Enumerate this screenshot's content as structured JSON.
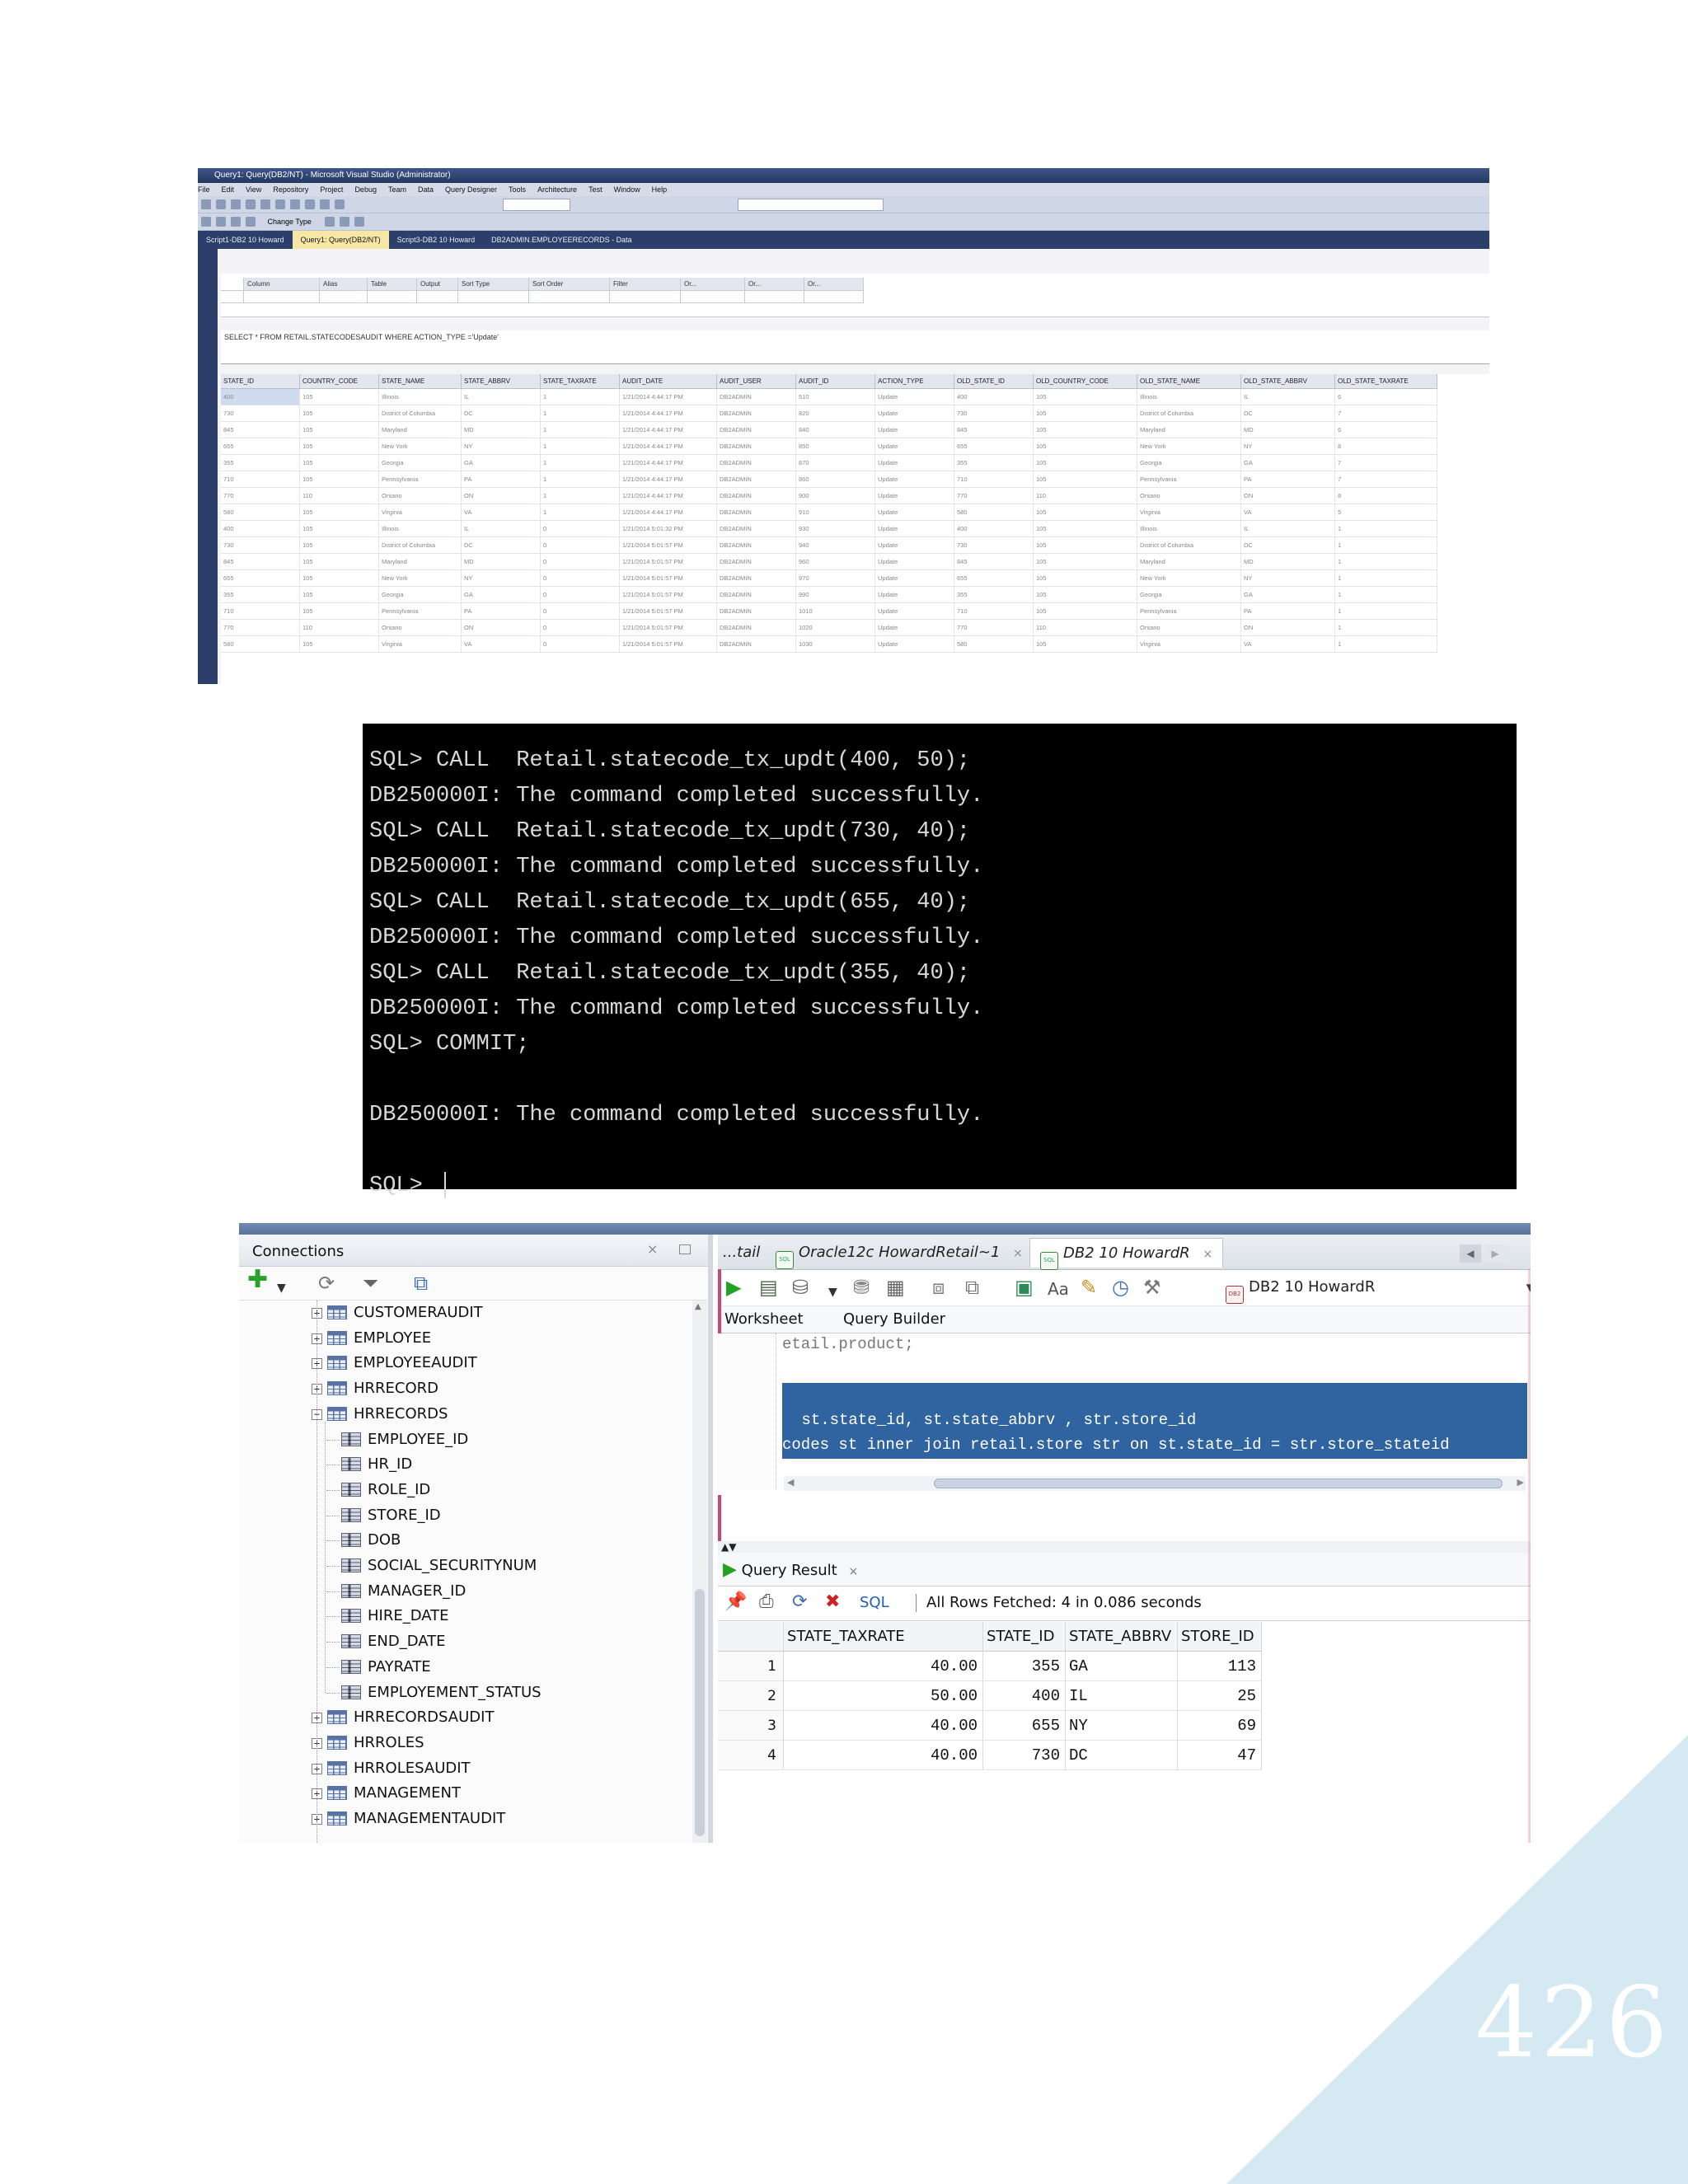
{
  "page_number": "426",
  "visual_studio": {
    "title": "Query1: Query(DB2/NT) - Microsoft Visual Studio (Administrator)",
    "menu": [
      "File",
      "Edit",
      "View",
      "Repository",
      "Project",
      "Debug",
      "Team",
      "Data",
      "Query Designer",
      "Tools",
      "Architecture",
      "Test",
      "Window",
      "Help"
    ],
    "change_type_label": "Change Type",
    "tabs": [
      "Script1-DB2 10 Howard",
      "Query1: Query(DB2/NT)",
      "Script3-DB2 10 Howard",
      "DB2ADMIN.EMPLOYEERECORDS - Data"
    ],
    "criteria_headers": [
      "Column",
      "Alias",
      "Table",
      "Output",
      "Sort Type",
      "Sort Order",
      "Filter",
      "Or...",
      "Or...",
      "Or..."
    ],
    "sql_text": "SELECT * FROM RETAIL.STATECODESAUDIT WHERE ACTION_TYPE ='Update'",
    "result_columns": [
      "STATE_ID",
      "COUNTRY_CODE",
      "STATE_NAME",
      "STATE_ABBRV",
      "STATE_TAXRATE",
      "AUDIT_DATE",
      "AUDIT_USER",
      "AUDIT_ID",
      "ACTION_TYPE",
      "OLD_STATE_ID",
      "OLD_COUNTRY_CODE",
      "OLD_STATE_NAME",
      "OLD_STATE_ABBRV",
      "OLD_STATE_TAXRATE"
    ],
    "result_rows": [
      [
        "400",
        "105",
        "Illinois",
        "IL",
        "1",
        "1/21/2014 4:44:17 PM",
        "DB2ADMIN",
        "510",
        "Update",
        "400",
        "105",
        "Illinois",
        "IL",
        "6"
      ],
      [
        "730",
        "105",
        "District of Columbia",
        "DC",
        "1",
        "1/21/2014 4:44:17 PM",
        "DB2ADMIN",
        "820",
        "Update",
        "730",
        "105",
        "District of Columbia",
        "DC",
        "7"
      ],
      [
        "845",
        "105",
        "Maryland",
        "MD",
        "1",
        "1/21/2014 4:44:17 PM",
        "DB2ADMIN",
        "840",
        "Update",
        "845",
        "105",
        "Maryland",
        "MD",
        "6"
      ],
      [
        "655",
        "105",
        "New York",
        "NY",
        "1",
        "1/21/2014 4:44:17 PM",
        "DB2ADMIN",
        "850",
        "Update",
        "655",
        "105",
        "New York",
        "NY",
        "8"
      ],
      [
        "355",
        "105",
        "Georgia",
        "GA",
        "1",
        "1/21/2014 4:44:17 PM",
        "DB2ADMIN",
        "870",
        "Update",
        "355",
        "105",
        "Georgia",
        "GA",
        "7"
      ],
      [
        "710",
        "105",
        "Pennsylvania",
        "PA",
        "1",
        "1/21/2014 4:44:17 PM",
        "DB2ADMIN",
        "860",
        "Update",
        "710",
        "105",
        "Pennsylvania",
        "PA",
        "7"
      ],
      [
        "770",
        "110",
        "Ontario",
        "ON",
        "1",
        "1/21/2014 4:44:17 PM",
        "DB2ADMIN",
        "900",
        "Update",
        "770",
        "110",
        "Ontario",
        "ON",
        "8"
      ],
      [
        "580",
        "105",
        "Virginia",
        "VA",
        "1",
        "1/21/2014 4:44:17 PM",
        "DB2ADMIN",
        "910",
        "Update",
        "580",
        "105",
        "Virginia",
        "VA",
        "5"
      ],
      [
        "400",
        "105",
        "Illinois",
        "IL",
        "0",
        "1/21/2014 5:01:32 PM",
        "DB2ADMIN",
        "930",
        "Update",
        "400",
        "105",
        "Illinois",
        "IL",
        "1"
      ],
      [
        "730",
        "105",
        "District of Columbia",
        "DC",
        "0",
        "1/21/2014 5:01:57 PM",
        "DB2ADMIN",
        "940",
        "Update",
        "730",
        "105",
        "District of Columbia",
        "DC",
        "1"
      ],
      [
        "845",
        "105",
        "Maryland",
        "MD",
        "0",
        "1/21/2014 5:01:57 PM",
        "DB2ADMIN",
        "960",
        "Update",
        "845",
        "105",
        "Maryland",
        "MD",
        "1"
      ],
      [
        "655",
        "105",
        "New York",
        "NY",
        "0",
        "1/21/2014 5:01:57 PM",
        "DB2ADMIN",
        "970",
        "Update",
        "655",
        "105",
        "New York",
        "NY",
        "1"
      ],
      [
        "355",
        "105",
        "Georgia",
        "GA",
        "0",
        "1/21/2014 5:01:57 PM",
        "DB2ADMIN",
        "990",
        "Update",
        "355",
        "105",
        "Georgia",
        "GA",
        "1"
      ],
      [
        "710",
        "105",
        "Pennsylvania",
        "PA",
        "0",
        "1/21/2014 5:01:57 PM",
        "DB2ADMIN",
        "1010",
        "Update",
        "710",
        "105",
        "Pennsylvania",
        "PA",
        "1"
      ],
      [
        "770",
        "110",
        "Ontario",
        "ON",
        "0",
        "1/21/2014 5:01:57 PM",
        "DB2ADMIN",
        "1020",
        "Update",
        "770",
        "110",
        "Ontario",
        "ON",
        "1"
      ],
      [
        "580",
        "105",
        "Virginia",
        "VA",
        "0",
        "1/21/2014 5:01:57 PM",
        "DB2ADMIN",
        "1030",
        "Update",
        "580",
        "105",
        "Virginia",
        "VA",
        "1"
      ]
    ]
  },
  "terminal": {
    "lines": [
      "SQL> CALL  Retail.statecode_tx_updt(400, 50);",
      "DB250000I: The command completed successfully.",
      "SQL> CALL  Retail.statecode_tx_updt(730, 40);",
      "DB250000I: The command completed successfully.",
      "SQL> CALL  Retail.statecode_tx_updt(655, 40);",
      "DB250000I: The command completed successfully.",
      "SQL> CALL  Retail.statecode_tx_updt(355, 40);",
      "DB250000I: The command completed successfully.",
      "SQL> COMMIT;",
      "",
      "DB250000I: The command completed successfully.",
      "",
      "SQL> "
    ]
  },
  "sql_developer": {
    "connections_title": "Connections",
    "tree": [
      {
        "label": "CUSTOMERAUDIT",
        "type": "table",
        "expanded": false
      },
      {
        "label": "EMPLOYEE",
        "type": "table",
        "expanded": false
      },
      {
        "label": "EMPLOYEEAUDIT",
        "type": "table",
        "expanded": false
      },
      {
        "label": "HRRECORD",
        "type": "table",
        "expanded": false
      },
      {
        "label": "HRRECORDS",
        "type": "table",
        "expanded": true
      },
      {
        "label": "EMPLOYEE_ID",
        "type": "column"
      },
      {
        "label": "HR_ID",
        "type": "column"
      },
      {
        "label": "ROLE_ID",
        "type": "column"
      },
      {
        "label": "STORE_ID",
        "type": "column"
      },
      {
        "label": "DOB",
        "type": "column"
      },
      {
        "label": "SOCIAL_SECURITYNUM",
        "type": "column"
      },
      {
        "label": "MANAGER_ID",
        "type": "column"
      },
      {
        "label": "HIRE_DATE",
        "type": "column"
      },
      {
        "label": "END_DATE",
        "type": "column"
      },
      {
        "label": "PAYRATE",
        "type": "column"
      },
      {
        "label": "EMPLOYEMENT_STATUS",
        "type": "column"
      },
      {
        "label": "HRRECORDSAUDIT",
        "type": "table",
        "expanded": false
      },
      {
        "label": "HRROLES",
        "type": "table",
        "expanded": false
      },
      {
        "label": "HRROLESAUDIT",
        "type": "table",
        "expanded": false
      },
      {
        "label": "MANAGEMENT",
        "type": "table",
        "expanded": false
      },
      {
        "label": "MANAGEMENTAUDIT",
        "type": "table",
        "expanded": false
      }
    ],
    "tabs": [
      {
        "label": "...tail"
      },
      {
        "label": "Oracle12c HowardRetail~1"
      },
      {
        "label": "DB2 10 HowardR"
      }
    ],
    "connection_select": "DB2 10 HowardR",
    "subtabs": [
      "Worksheet",
      "Query Builder"
    ],
    "code_lines": [
      "etail.product;",
      "",
      "",
      " st.state_id, st.state_abbrv , str.store_id",
      "codes st inner join retail.store str on st.state_id = str.store_stateid"
    ],
    "query_result_tab": "Query Result",
    "sql_link": "SQL",
    "fetch_status": "All Rows Fetched: 4 in 0.086 seconds",
    "result_columns": [
      "STATE_TAXRATE",
      "STATE_ID",
      "STATE_ABBRV",
      "STORE_ID"
    ],
    "result_rows": [
      [
        "1",
        "40.00",
        "355",
        "GA",
        "113"
      ],
      [
        "2",
        "50.00",
        "400",
        "IL",
        "25"
      ],
      [
        "3",
        "40.00",
        "655",
        "NY",
        "69"
      ],
      [
        "4",
        "40.00",
        "730",
        "DC",
        "47"
      ]
    ]
  }
}
